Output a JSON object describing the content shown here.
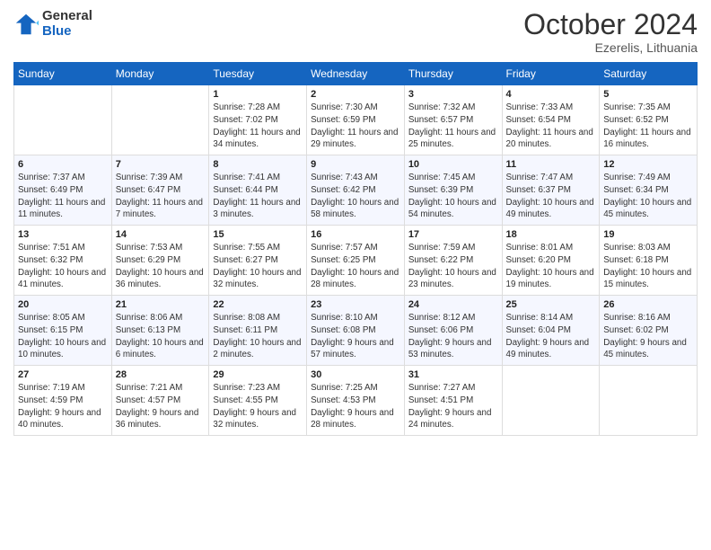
{
  "header": {
    "logo_general": "General",
    "logo_blue": "Blue",
    "month_title": "October 2024",
    "subtitle": "Ezerelis, Lithuania"
  },
  "days_of_week": [
    "Sunday",
    "Monday",
    "Tuesday",
    "Wednesday",
    "Thursday",
    "Friday",
    "Saturday"
  ],
  "weeks": [
    [
      {
        "day": "",
        "detail": ""
      },
      {
        "day": "",
        "detail": ""
      },
      {
        "day": "1",
        "detail": "Sunrise: 7:28 AM\nSunset: 7:02 PM\nDaylight: 11 hours and 34 minutes."
      },
      {
        "day": "2",
        "detail": "Sunrise: 7:30 AM\nSunset: 6:59 PM\nDaylight: 11 hours and 29 minutes."
      },
      {
        "day": "3",
        "detail": "Sunrise: 7:32 AM\nSunset: 6:57 PM\nDaylight: 11 hours and 25 minutes."
      },
      {
        "day": "4",
        "detail": "Sunrise: 7:33 AM\nSunset: 6:54 PM\nDaylight: 11 hours and 20 minutes."
      },
      {
        "day": "5",
        "detail": "Sunrise: 7:35 AM\nSunset: 6:52 PM\nDaylight: 11 hours and 16 minutes."
      }
    ],
    [
      {
        "day": "6",
        "detail": "Sunrise: 7:37 AM\nSunset: 6:49 PM\nDaylight: 11 hours and 11 minutes."
      },
      {
        "day": "7",
        "detail": "Sunrise: 7:39 AM\nSunset: 6:47 PM\nDaylight: 11 hours and 7 minutes."
      },
      {
        "day": "8",
        "detail": "Sunrise: 7:41 AM\nSunset: 6:44 PM\nDaylight: 11 hours and 3 minutes."
      },
      {
        "day": "9",
        "detail": "Sunrise: 7:43 AM\nSunset: 6:42 PM\nDaylight: 10 hours and 58 minutes."
      },
      {
        "day": "10",
        "detail": "Sunrise: 7:45 AM\nSunset: 6:39 PM\nDaylight: 10 hours and 54 minutes."
      },
      {
        "day": "11",
        "detail": "Sunrise: 7:47 AM\nSunset: 6:37 PM\nDaylight: 10 hours and 49 minutes."
      },
      {
        "day": "12",
        "detail": "Sunrise: 7:49 AM\nSunset: 6:34 PM\nDaylight: 10 hours and 45 minutes."
      }
    ],
    [
      {
        "day": "13",
        "detail": "Sunrise: 7:51 AM\nSunset: 6:32 PM\nDaylight: 10 hours and 41 minutes."
      },
      {
        "day": "14",
        "detail": "Sunrise: 7:53 AM\nSunset: 6:29 PM\nDaylight: 10 hours and 36 minutes."
      },
      {
        "day": "15",
        "detail": "Sunrise: 7:55 AM\nSunset: 6:27 PM\nDaylight: 10 hours and 32 minutes."
      },
      {
        "day": "16",
        "detail": "Sunrise: 7:57 AM\nSunset: 6:25 PM\nDaylight: 10 hours and 28 minutes."
      },
      {
        "day": "17",
        "detail": "Sunrise: 7:59 AM\nSunset: 6:22 PM\nDaylight: 10 hours and 23 minutes."
      },
      {
        "day": "18",
        "detail": "Sunrise: 8:01 AM\nSunset: 6:20 PM\nDaylight: 10 hours and 19 minutes."
      },
      {
        "day": "19",
        "detail": "Sunrise: 8:03 AM\nSunset: 6:18 PM\nDaylight: 10 hours and 15 minutes."
      }
    ],
    [
      {
        "day": "20",
        "detail": "Sunrise: 8:05 AM\nSunset: 6:15 PM\nDaylight: 10 hours and 10 minutes."
      },
      {
        "day": "21",
        "detail": "Sunrise: 8:06 AM\nSunset: 6:13 PM\nDaylight: 10 hours and 6 minutes."
      },
      {
        "day": "22",
        "detail": "Sunrise: 8:08 AM\nSunset: 6:11 PM\nDaylight: 10 hours and 2 minutes."
      },
      {
        "day": "23",
        "detail": "Sunrise: 8:10 AM\nSunset: 6:08 PM\nDaylight: 9 hours and 57 minutes."
      },
      {
        "day": "24",
        "detail": "Sunrise: 8:12 AM\nSunset: 6:06 PM\nDaylight: 9 hours and 53 minutes."
      },
      {
        "day": "25",
        "detail": "Sunrise: 8:14 AM\nSunset: 6:04 PM\nDaylight: 9 hours and 49 minutes."
      },
      {
        "day": "26",
        "detail": "Sunrise: 8:16 AM\nSunset: 6:02 PM\nDaylight: 9 hours and 45 minutes."
      }
    ],
    [
      {
        "day": "27",
        "detail": "Sunrise: 7:19 AM\nSunset: 4:59 PM\nDaylight: 9 hours and 40 minutes."
      },
      {
        "day": "28",
        "detail": "Sunrise: 7:21 AM\nSunset: 4:57 PM\nDaylight: 9 hours and 36 minutes."
      },
      {
        "day": "29",
        "detail": "Sunrise: 7:23 AM\nSunset: 4:55 PM\nDaylight: 9 hours and 32 minutes."
      },
      {
        "day": "30",
        "detail": "Sunrise: 7:25 AM\nSunset: 4:53 PM\nDaylight: 9 hours and 28 minutes."
      },
      {
        "day": "31",
        "detail": "Sunrise: 7:27 AM\nSunset: 4:51 PM\nDaylight: 9 hours and 24 minutes."
      },
      {
        "day": "",
        "detail": ""
      },
      {
        "day": "",
        "detail": ""
      }
    ]
  ]
}
